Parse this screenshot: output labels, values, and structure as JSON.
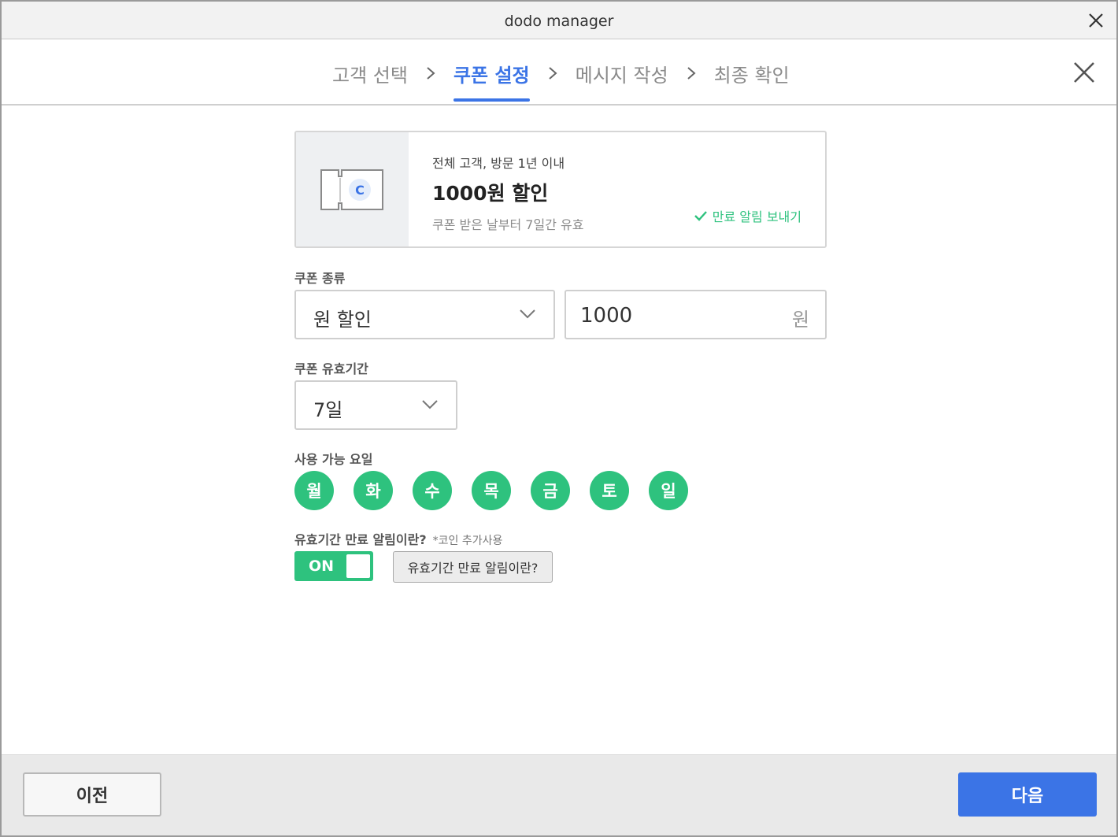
{
  "window": {
    "title": "dodo manager"
  },
  "steps": [
    {
      "label": "고객 선택",
      "active": false
    },
    {
      "label": "쿠폰 설정",
      "active": true
    },
    {
      "label": "메시지 작성",
      "active": false
    },
    {
      "label": "최종 확인",
      "active": false
    }
  ],
  "coupon_preview": {
    "icon_letter": "C",
    "target": "전체 고객, 방문 1년 이내",
    "amount": "1000원 할인",
    "validity": "쿠폰 받은 날부터 7일간 유효",
    "notify_label": "만료 알림 보내기"
  },
  "coupon_type": {
    "label": "쿠폰 종류",
    "selected": "원 할인",
    "amount_value": "1000",
    "amount_unit": "원"
  },
  "validity_period": {
    "label": "쿠폰 유효기간",
    "selected": "7일"
  },
  "available_days": {
    "label": "사용 가능 요일",
    "days": [
      "월",
      "화",
      "수",
      "목",
      "금",
      "토",
      "일"
    ]
  },
  "expiry_notice": {
    "label": "유효기간 만료 알림이란?",
    "sub_label": "*코인 추가사용",
    "toggle_label": "ON",
    "toggle_on": true,
    "help_button": "유효기간 만료 알림이란?"
  },
  "footer": {
    "prev_label": "이전",
    "next_label": "다음"
  },
  "colors": {
    "accent_blue": "#3b74e6",
    "accent_green": "#2ec27e"
  }
}
